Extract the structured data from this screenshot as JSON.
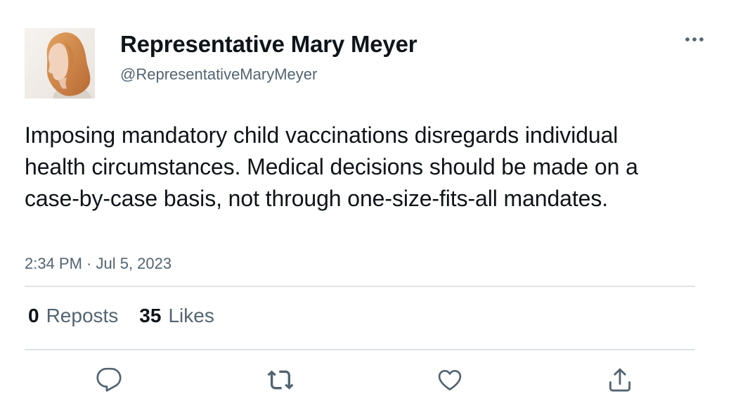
{
  "author": {
    "display_name": "Representative Mary Meyer",
    "handle": "@RepresentativeMaryMeyer"
  },
  "tweet": {
    "text": "Imposing mandatory child vaccinations disregards individual health circumstances. Medical decisions should be made on a case-by-case basis, not through one-size-fits-all mandates.",
    "timestamp": "2:34 PM · Jul 5, 2023"
  },
  "stats": {
    "reposts_count": "0",
    "reposts_label": "Reposts",
    "likes_count": "35",
    "likes_label": "Likes"
  },
  "icons": {
    "more": "more-horizontal-icon",
    "reply": "reply-icon",
    "repost": "repost-icon",
    "like": "heart-icon",
    "share": "share-icon"
  },
  "colors": {
    "text_primary": "#0f1419",
    "text_secondary": "#536471",
    "divider": "#dfe3e6",
    "icon": "#536471"
  }
}
